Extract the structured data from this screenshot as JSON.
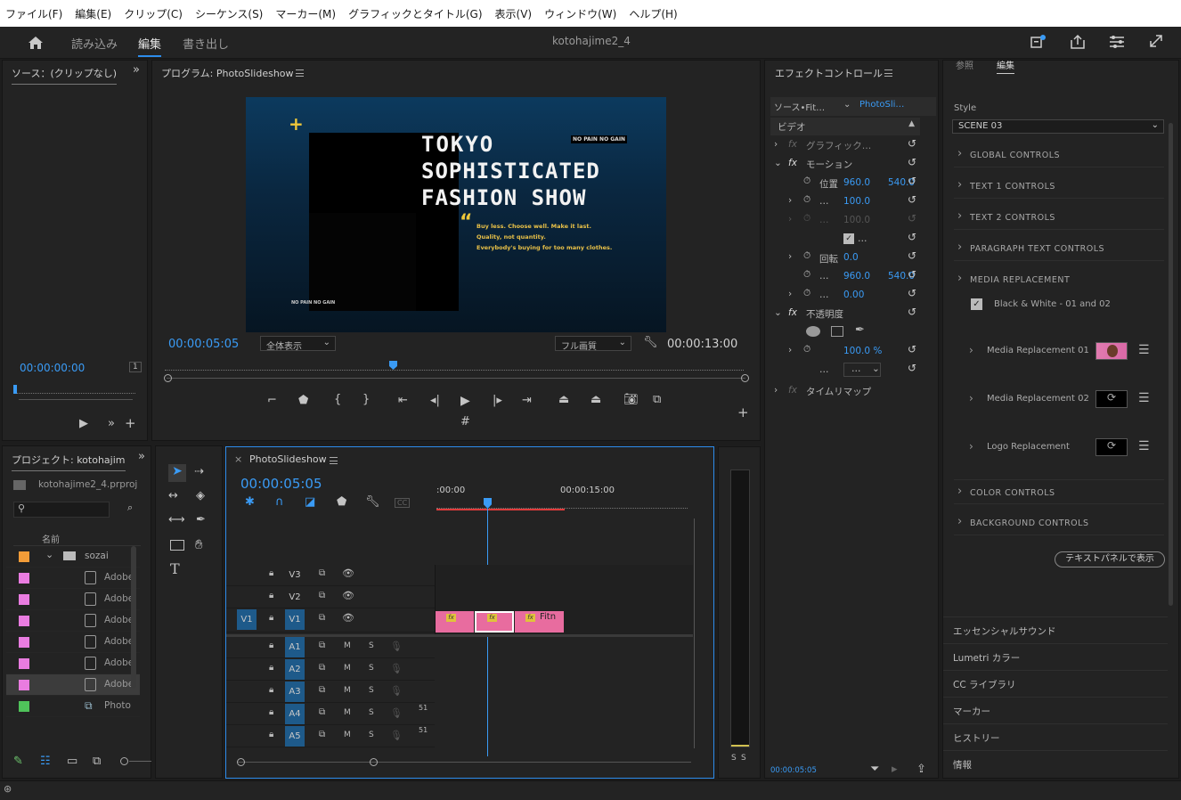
{
  "menu": [
    "ファイル(F)",
    "編集(E)",
    "クリップ(C)",
    "シーケンス(S)",
    "マーカー(M)",
    "グラフィックとタイトル(G)",
    "表示(V)",
    "ウィンドウ(W)",
    "ヘルプ(H)"
  ],
  "workspace": {
    "import": "読み込み",
    "edit": "編集",
    "export": "書き出し",
    "project_title": "kotohajime2_4"
  },
  "source": {
    "title": "ソース：(クリップなし)",
    "timecode": "00:00:00:00",
    "zoom": "1"
  },
  "program": {
    "title": "プログラム: PhotoSlideshow",
    "timecode": "00:00:05:05",
    "duration": "00:00:13:00",
    "fit": "全体表示",
    "quality": "フル画質",
    "preview": {
      "title_line1": "TOKYO",
      "title_line2": "SOPHISTICATED",
      "title_line3": "FASHION SHOW",
      "badge": "NO PAIN NO GAIN",
      "badge_bottom": "NO PAIN NO GAIN",
      "quote1": "Buy less. Choose well. Make it last.",
      "quote2": "Quality, not quantity.",
      "quote3": "Everybody's buying for too many clothes."
    }
  },
  "effects": {
    "title": "エフェクトコントロール",
    "source_tab": "ソース•Fit…",
    "seq_tab": "PhotoSli…",
    "video": "ビデオ",
    "graphic": "グラフィック…",
    "motion": "モーション",
    "position_label": "位置",
    "pos_x": "960.0",
    "pos_y": "540.0",
    "scale": "100.0",
    "scale2": "100.0",
    "dots": "…",
    "rotation_label": "回転",
    "rotation": "0.0",
    "anchor_x": "960.0",
    "anchor_y": "540.0",
    "flicker": "0.00",
    "opacity": "不透明度",
    "opacity_val": "100.0 %",
    "blend": "…",
    "timeremap": "タイムリマップ",
    "timecode": "00:00:05:05"
  },
  "essential": {
    "tab1": "参照",
    "tab2": "編集",
    "style_label": "Style",
    "style_value": "SCENE 03",
    "sections": [
      "GLOBAL CONTROLS",
      "TEXT 1 CONTROLS",
      "TEXT 2 CONTROLS",
      "PARAGRAPH TEXT CONTROLS",
      "MEDIA REPLACEMENT"
    ],
    "checkbox": "Black & White - 01 and 02",
    "media1": "Media Replacement 01",
    "media2": "Media Replacement 02",
    "logo": "Logo Replacement",
    "sections2": [
      "COLOR CONTROLS",
      "BACKGROUND CONTROLS"
    ],
    "text_panel_btn": "テキストパネルで表示"
  },
  "side_panels": [
    "エッセンシャルサウンド",
    "Lumetri カラー",
    "CC ライブラリ",
    "マーカー",
    "ヒストリー",
    "情報"
  ],
  "project": {
    "title": "プロジェクト: kotohajim",
    "file": "kotohajime2_4.prproj",
    "col_name": "名前",
    "folder": "sozai",
    "items": [
      "Adobe",
      "Adobe",
      "Adobe",
      "Adobe",
      "Adobe",
      "Adobe",
      "Photo"
    ]
  },
  "timeline": {
    "title": "PhotoSlideshow",
    "timecode": "00:00:05:05",
    "t0": ":00:00",
    "t15": "00:00:15:00",
    "tracks_v": [
      "V3",
      "V2",
      "V1"
    ],
    "tracks_a": [
      "A1",
      "A2",
      "A3",
      "A4",
      "A5"
    ],
    "src_v1": "V1",
    "clip_label": "Fitn",
    "m": "M",
    "s": "S",
    "num": "51"
  },
  "meter": {
    "s1": "S",
    "s2": "S"
  },
  "colors": {
    "accent": "#2d8ceb",
    "clip": "#e86c9f",
    "fx": "#e0c23c"
  }
}
